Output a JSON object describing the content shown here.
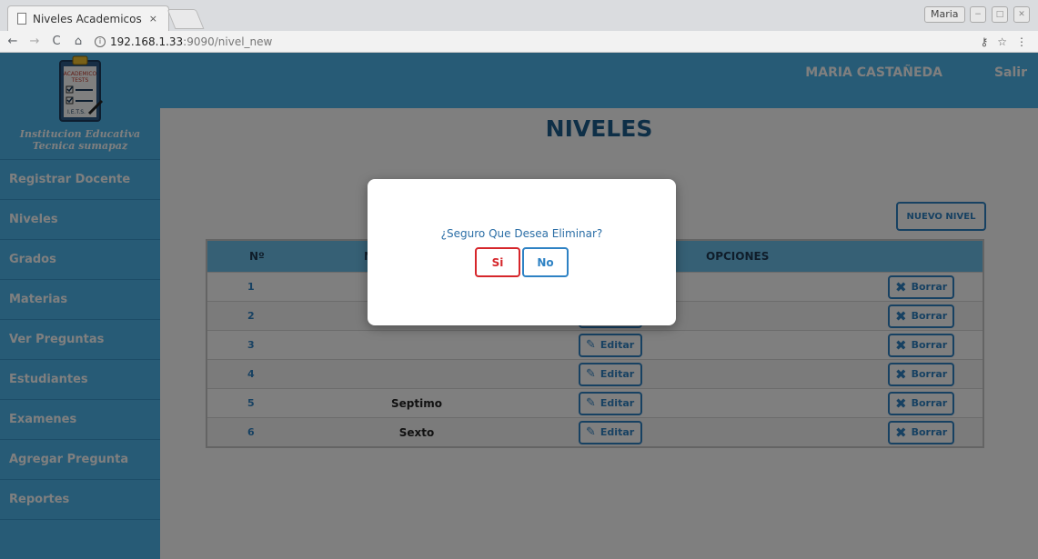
{
  "browser": {
    "tab_title": "Niveles Academicos",
    "tab_close": "×",
    "profile_name": "Maria",
    "url_host": "192.168.1.33",
    "url_path": ":9090/nivel_new",
    "info_icon": "ⓘ",
    "nav_back": "←",
    "nav_forward": "→",
    "reload": "C",
    "home": "⌂",
    "key_icon": "⚷",
    "star_icon": "☆",
    "menu_icon": "⋮",
    "win_min": "−",
    "win_max": "□",
    "win_close": "✕"
  },
  "sidebar": {
    "logo_text": "Institucion Educativa Tecnica sumapaz",
    "items": [
      {
        "label": "Registrar Docente"
      },
      {
        "label": "Niveles"
      },
      {
        "label": "Grados"
      },
      {
        "label": "Materias"
      },
      {
        "label": "Ver Preguntas"
      },
      {
        "label": "Estudiantes"
      },
      {
        "label": "Examenes"
      },
      {
        "label": "Agregar Pregunta"
      },
      {
        "label": "Reportes"
      }
    ]
  },
  "topbar": {
    "user_name": "MARIA CASTAÑEDA",
    "logout": "Salir"
  },
  "main": {
    "title": "NIVELES",
    "new_button": "NUEVO NIVEL",
    "table": {
      "headers": [
        "Nº",
        "",
        "OPCIONES"
      ],
      "name_header_visible": "N",
      "rows": [
        {
          "num": "1",
          "name": ""
        },
        {
          "num": "2",
          "name": ""
        },
        {
          "num": "3",
          "name": ""
        },
        {
          "num": "4",
          "name": ""
        },
        {
          "num": "5",
          "name": "Septimo"
        },
        {
          "num": "6",
          "name": "Sexto"
        }
      ],
      "edit_label": "Editar",
      "delete_label": "Borrar",
      "edit_icon": "✎",
      "delete_icon": "✖"
    }
  },
  "modal": {
    "question": "¿Seguro Que Desea Eliminar?",
    "yes": "Si",
    "no": "No"
  },
  "colors": {
    "sidebar_bg": "#4fb7ec",
    "accent_blue": "#2e82c4",
    "danger_red": "#d6262b",
    "title_blue": "#1d5e8f"
  }
}
